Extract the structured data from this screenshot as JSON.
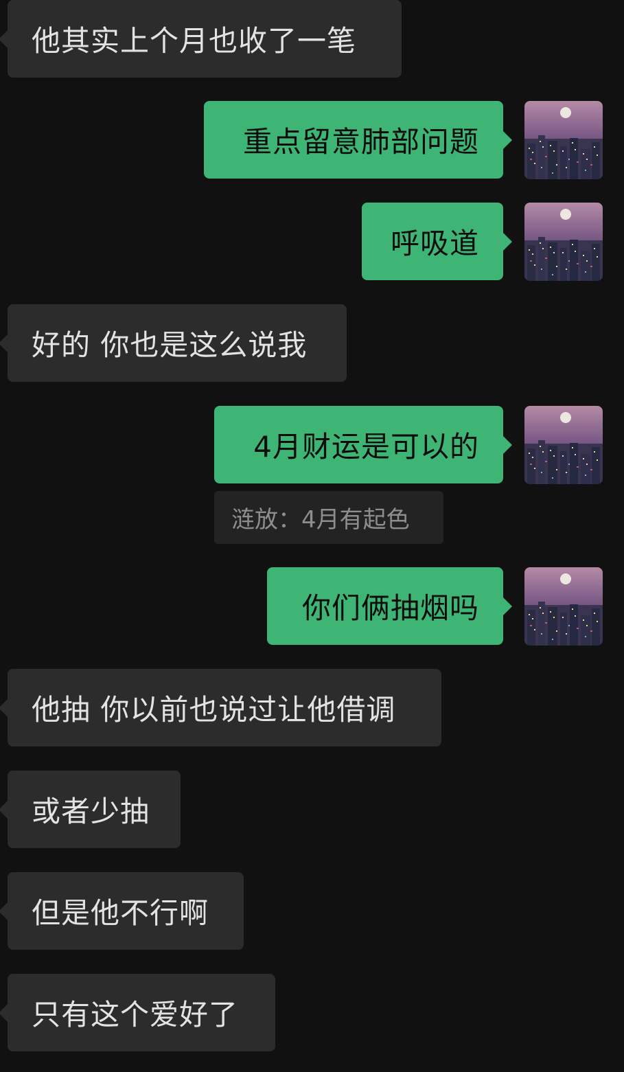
{
  "conversation": {
    "messages": [
      {
        "from": "other",
        "text": "他其实上个月也收了一笔"
      },
      {
        "from": "me",
        "text": "重点留意肺部问题"
      },
      {
        "from": "me",
        "text": "呼吸道"
      },
      {
        "from": "other",
        "text": "好的 你也是这么说我"
      },
      {
        "from": "me",
        "text": "4月财运是可以的"
      },
      {
        "from": "me",
        "text": "你们俩抽烟吗"
      },
      {
        "from": "other",
        "text": "他抽 你以前也说过让他借调"
      },
      {
        "from": "other",
        "text": "或者少抽"
      },
      {
        "from": "other",
        "text": "但是他不行啊"
      },
      {
        "from": "other",
        "text": "只有这个爱好了"
      }
    ],
    "quote": {
      "text": "涟放：4月有起色"
    },
    "avatar": {
      "icon": "city-night-moon-avatar"
    },
    "colors": {
      "background": "#111111",
      "incoming_bubble": "#2c2c2c",
      "outgoing_bubble": "#3eb575",
      "incoming_text": "#e3e3e3",
      "outgoing_text": "#0d0d0d",
      "quote_text": "#8e8e8e"
    }
  }
}
